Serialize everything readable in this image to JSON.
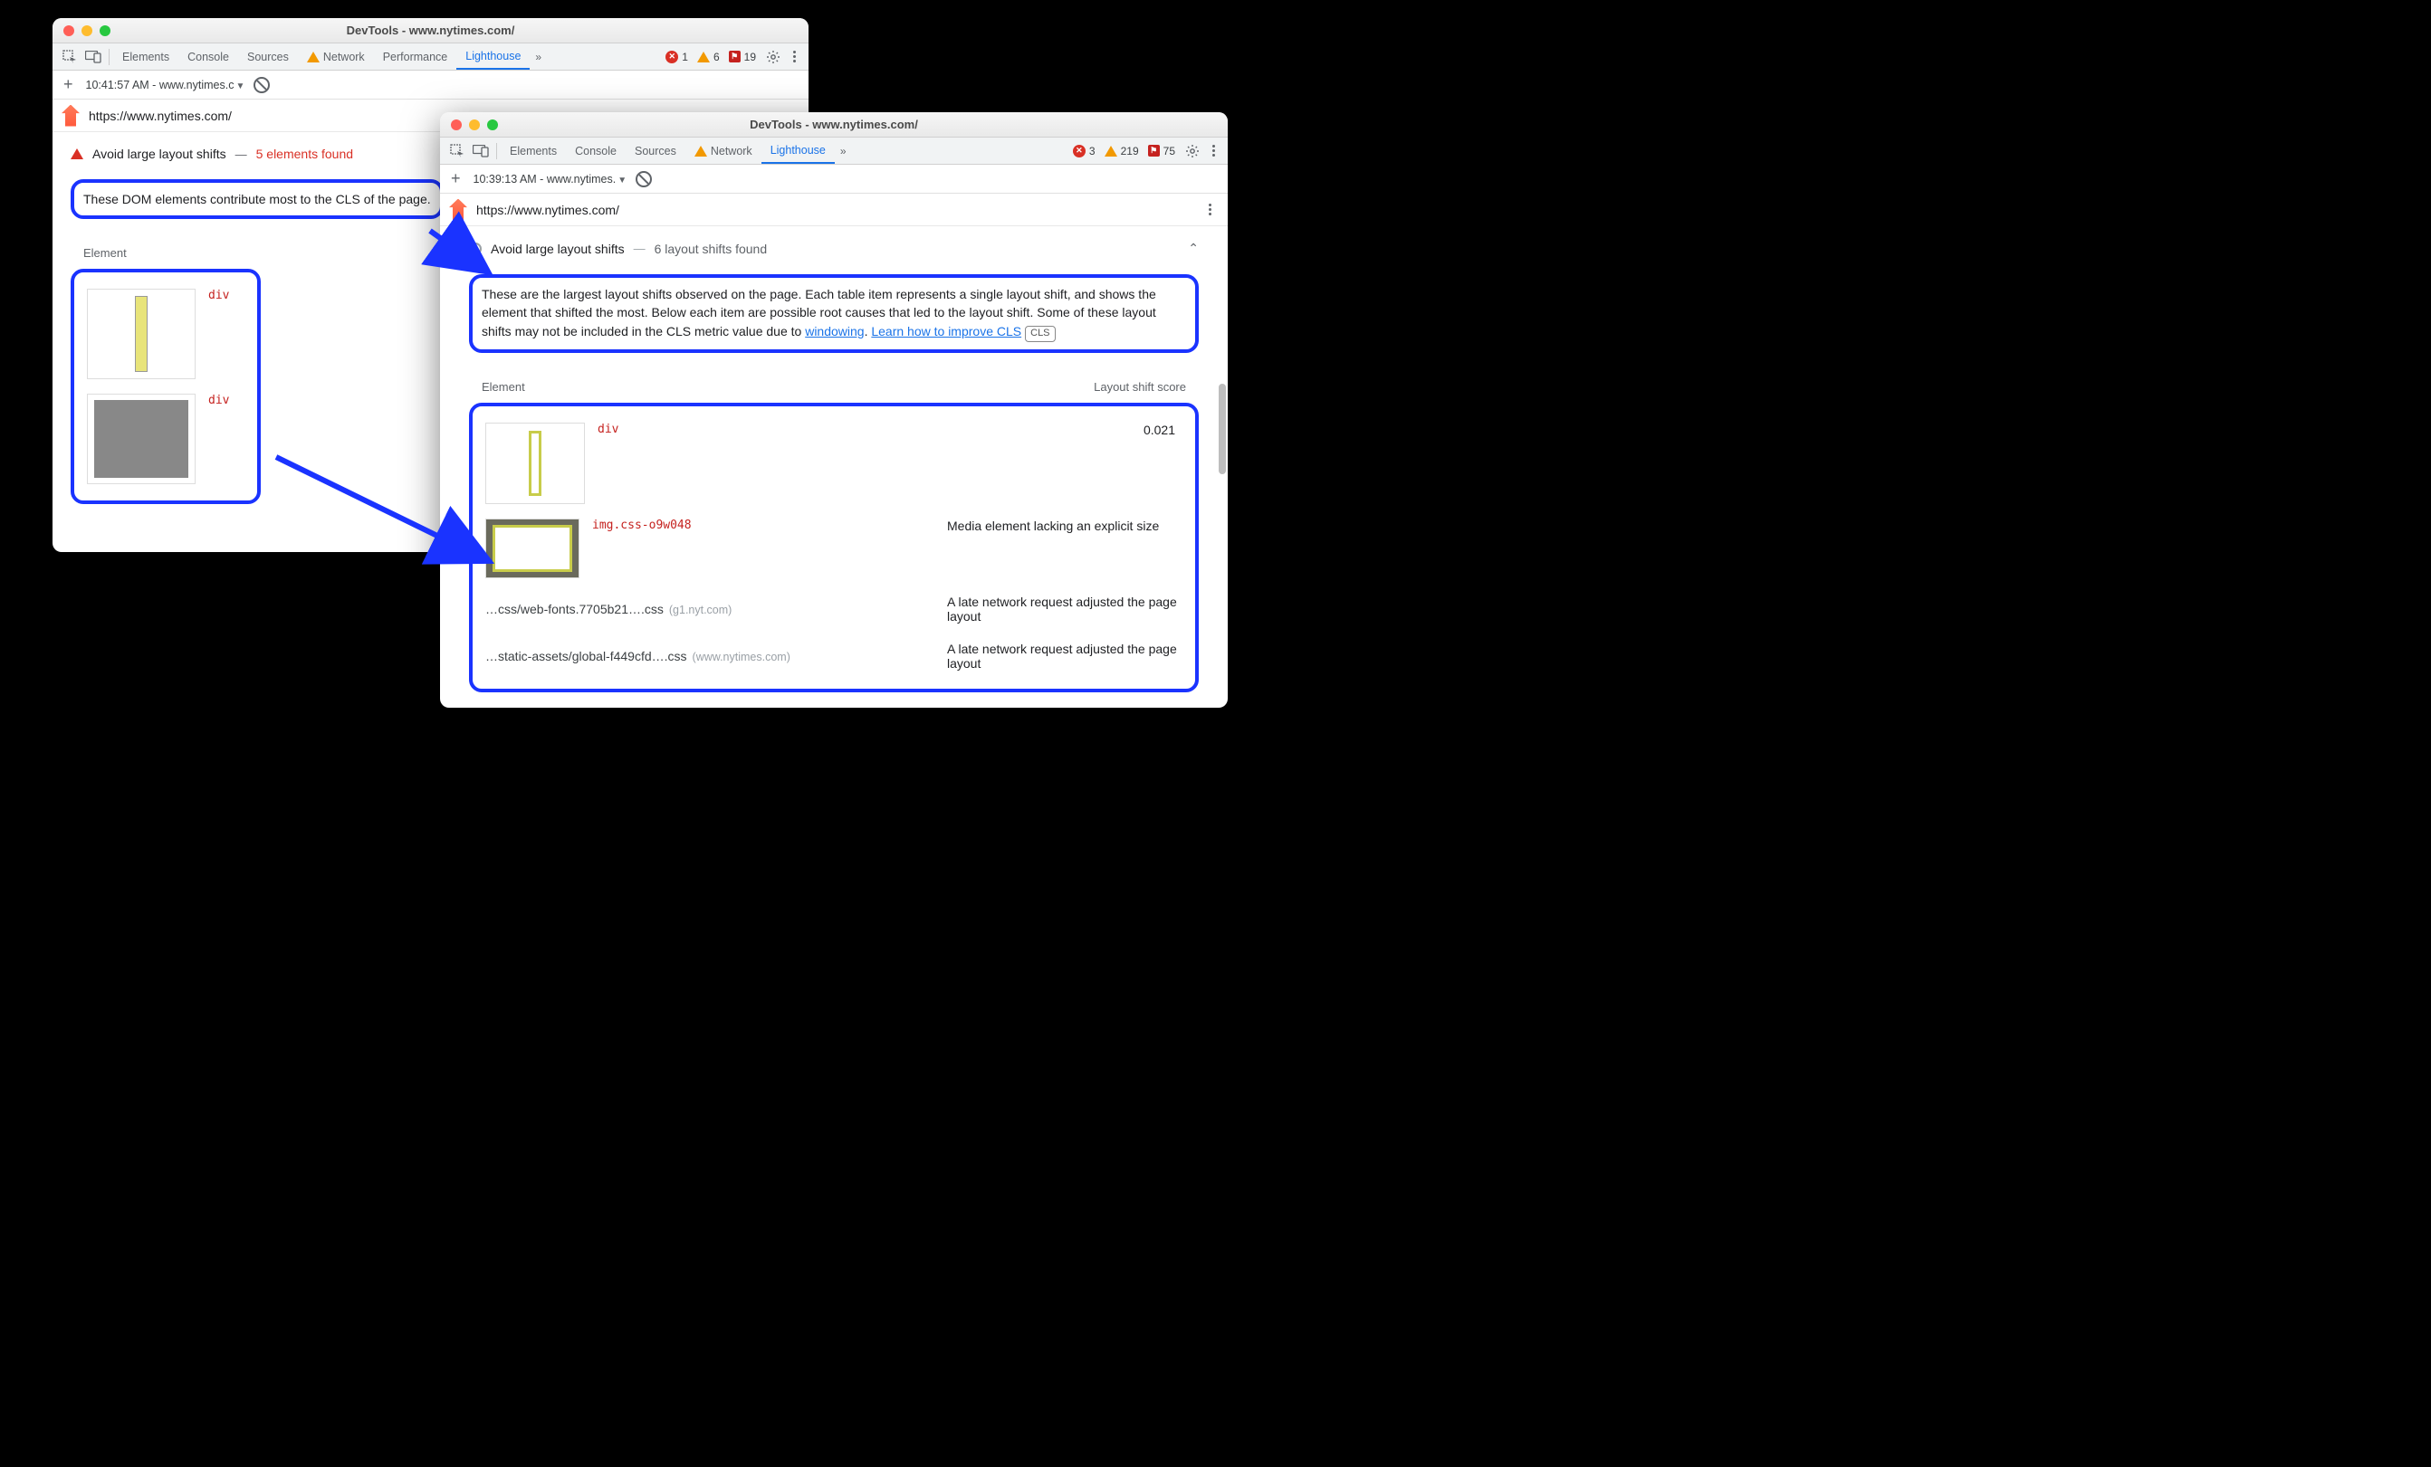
{
  "left": {
    "title": "DevTools - www.nytimes.com/",
    "tabs": [
      "Elements",
      "Console",
      "Sources",
      "Network",
      "Performance",
      "Lighthouse"
    ],
    "activeTab": "Lighthouse",
    "networkWarn": true,
    "counts": {
      "errors": "1",
      "warnings": "6",
      "info": "19"
    },
    "run": "10:41:57 AM - www.nytimes.c",
    "url": "https://www.nytimes.com/",
    "audit": {
      "title": "Avoid large layout shifts",
      "sub": "5 elements found",
      "desc": "These DOM elements contribute most to the CLS of the page.",
      "th": "Element",
      "rows": [
        {
          "code": "div"
        },
        {
          "code": "div"
        }
      ]
    }
  },
  "right": {
    "title": "DevTools - www.nytimes.com/",
    "tabs": [
      "Elements",
      "Console",
      "Sources",
      "Network",
      "Lighthouse"
    ],
    "activeTab": "Lighthouse",
    "networkWarn": true,
    "counts": {
      "errors": "3",
      "warnings": "219",
      "info": "75"
    },
    "run": "10:39:13 AM - www.nytimes.",
    "url": "https://www.nytimes.com/",
    "audit": {
      "title": "Avoid large layout shifts",
      "sub": "6 layout shifts found",
      "desc1": "These are the largest layout shifts observed on the page. Each table item represents a single layout shift, and shows the element that shifted the most. Below each item are possible root causes that led to the layout shift. Some of these layout shifts may not be included in the CLS metric value due to ",
      "descLink1": "windowing",
      "descDot": ". ",
      "descLink2": "Learn how to improve CLS",
      "clsTag": "CLS",
      "th1": "Element",
      "th2": "Layout shift score",
      "row1": {
        "code": "div",
        "score": "0.021"
      },
      "row2": {
        "code": "img.css-o9w048",
        "cause": "Media element lacking an explicit size"
      },
      "cause1": {
        "left": "…css/web-fonts.7705b21….css",
        "muted": "(g1.nyt.com)",
        "right": "A late network request adjusted the page layout"
      },
      "cause2": {
        "left": "…static-assets/global-f449cfd….css",
        "muted": "(www.nytimes.com)",
        "right": "A late network request adjusted the page layout"
      }
    }
  }
}
